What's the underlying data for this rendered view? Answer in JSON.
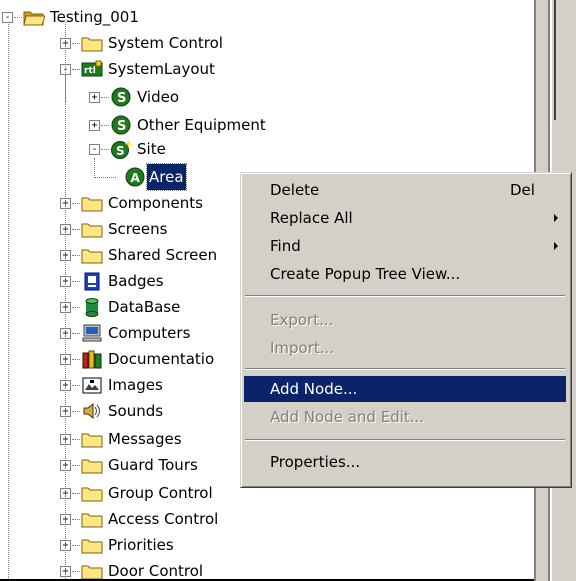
{
  "tree": {
    "nodes": [
      {
        "label": "Testing_001",
        "icon": "open-folder-icon",
        "expander": "-"
      },
      {
        "label": "System Control",
        "icon": "folder-icon",
        "expander": "+"
      },
      {
        "label": "SystemLayout",
        "icon": "rtl-layout-icon",
        "expander": "-"
      },
      {
        "label": "Video",
        "icon": "green-s-icon",
        "expander": "+"
      },
      {
        "label": "Other Equipment",
        "icon": "green-s-icon",
        "expander": "+"
      },
      {
        "label": "Site",
        "icon": "green-s-plus-icon",
        "expander": "-"
      },
      {
        "label": "Area",
        "icon": "green-a-icon",
        "expander": ""
      },
      {
        "label": "Components",
        "icon": "folder-icon",
        "expander": "+"
      },
      {
        "label": "Screens",
        "icon": "folder-icon",
        "expander": "+"
      },
      {
        "label": "Shared Screen",
        "icon": "folder-icon",
        "expander": "+"
      },
      {
        "label": "Badges",
        "icon": "badge-icon",
        "expander": "+"
      },
      {
        "label": "DataBase",
        "icon": "database-icon",
        "expander": "+"
      },
      {
        "label": "Computers",
        "icon": "computer-icon",
        "expander": "+"
      },
      {
        "label": "Documentatio",
        "icon": "books-icon",
        "expander": "+"
      },
      {
        "label": "Images",
        "icon": "images-icon",
        "expander": "+"
      },
      {
        "label": "Sounds",
        "icon": "speaker-icon",
        "expander": "+"
      },
      {
        "label": "Messages",
        "icon": "folder-icon",
        "expander": "+"
      },
      {
        "label": "Guard Tours",
        "icon": "folder-icon",
        "expander": "+"
      },
      {
        "label": "Group Control",
        "icon": "folder-icon",
        "expander": "+"
      },
      {
        "label": "Access Control",
        "icon": "folder-icon",
        "expander": "+"
      },
      {
        "label": "Priorities",
        "icon": "folder-icon",
        "expander": "+"
      },
      {
        "label": "Door Control",
        "icon": "folder-icon",
        "expander": "+"
      }
    ]
  },
  "context_menu": {
    "items": [
      {
        "label": "Delete",
        "shortcut": "Del"
      },
      {
        "label": "Replace All"
      },
      {
        "label": "Find"
      },
      {
        "label": "Create Popup Tree View..."
      },
      {
        "label": "Export..."
      },
      {
        "label": "Import..."
      },
      {
        "label": "Add Node..."
      },
      {
        "label": "Add Node and Edit..."
      },
      {
        "label": "Properties..."
      }
    ]
  },
  "colors": {
    "selection": "#0a246a",
    "menu_bg": "#d4d0c8",
    "folder": "#ffe680",
    "green_node": "#1f7a1f"
  }
}
